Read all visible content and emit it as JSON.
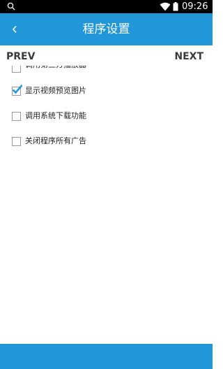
{
  "status_bar": {
    "time": "09:26",
    "search_icon": "search-icon",
    "wifi_icon": "wifi-icon",
    "battery_icon": "battery-icon"
  },
  "app_bar": {
    "title": "程序设置",
    "back_icon": "chevron-left-icon",
    "color": "#2196d8"
  },
  "nav": {
    "prev": "PREV",
    "next": "NEXT"
  },
  "settings": [
    {
      "label": "调用第三方播放器",
      "checked": false
    },
    {
      "label": "显示视频预览图片",
      "checked": true
    },
    {
      "label": "调用系统下载功能",
      "checked": false
    },
    {
      "label": "关闭程序所有广告",
      "checked": false
    }
  ]
}
